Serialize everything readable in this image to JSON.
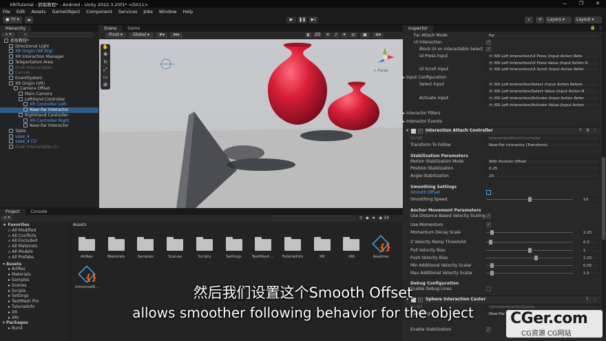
{
  "window": {
    "title": "XRITutorial - 抓取教程* - Android - Unity 2022.3.20f1* <DX11>",
    "controls": [
      "—",
      "❐",
      "✕"
    ]
  },
  "menu": [
    "File",
    "Edit",
    "Assets",
    "GameObject",
    "Component",
    "Services",
    "Jobs",
    "Window",
    "Help"
  ],
  "toolbar": {
    "account": "YY",
    "layers": "Layers",
    "layout": "Layout"
  },
  "hierarchy": {
    "tab": "Hierarchy",
    "search_placeholder": "All",
    "rows": [
      {
        "label": "抓取教程*",
        "indent": 0,
        "style": "normal"
      },
      {
        "label": "Directional Light",
        "indent": 1,
        "style": "normal"
      },
      {
        "label": "XR Origin (XR Rig)",
        "indent": 1,
        "style": "blue"
      },
      {
        "label": "XR Interaction Manager",
        "indent": 1,
        "style": "normal"
      },
      {
        "label": "Teleportation Area",
        "indent": 1,
        "style": "normal"
      },
      {
        "label": "Grab Interactable",
        "indent": 1,
        "style": "dim"
      },
      {
        "label": "Canvas",
        "indent": 1,
        "style": "dim"
      },
      {
        "label": "EventSystem",
        "indent": 1,
        "style": "normal"
      },
      {
        "label": "XR Origin (VR)",
        "indent": 1,
        "style": "normal"
      },
      {
        "label": "Camera Offset",
        "indent": 2,
        "style": "normal"
      },
      {
        "label": "Main Camera",
        "indent": 3,
        "style": "normal"
      },
      {
        "label": "LeftHand Controller",
        "indent": 3,
        "style": "normal"
      },
      {
        "label": "XR Controller Left",
        "indent": 4,
        "style": "blue"
      },
      {
        "label": "Near-Far Interactor",
        "indent": 4,
        "style": "selected"
      },
      {
        "label": "RightHand Controller",
        "indent": 3,
        "style": "normal"
      },
      {
        "label": "XR Controller Right",
        "indent": 4,
        "style": "blue"
      },
      {
        "label": "Near-Far Interactor",
        "indent": 4,
        "style": "normal"
      },
      {
        "label": "Table",
        "indent": 1,
        "style": "normal"
      },
      {
        "label": "vase_4",
        "indent": 1,
        "style": "blue"
      },
      {
        "label": "vase_4 (1)",
        "indent": 1,
        "style": "blue"
      },
      {
        "label": "Grab Interactable (1)",
        "indent": 1,
        "style": "dim"
      }
    ]
  },
  "scene": {
    "tabs": [
      "Scene",
      "Game"
    ],
    "pivot": "Pivot",
    "global": "Global",
    "mode_2d": "2D",
    "persp_label": "< Persp"
  },
  "project": {
    "tabs": [
      "Project",
      "Console"
    ],
    "favorites_header": "Favorites",
    "favorites": [
      "All Modified",
      "All Conflicts",
      "All Excluded",
      "All Materials",
      "All Models",
      "All Prefabs"
    ],
    "assets_header": "Assets",
    "asset_tree": [
      "ArtRes",
      "Materials",
      "Samples",
      "Scenes",
      "Scripts",
      "Settings",
      "TextMesh Pro",
      "TutorialInfo",
      "XR",
      "XRI"
    ],
    "packages_header": "Packages",
    "packages": [
      "Burst"
    ],
    "breadcrumb": "Assets",
    "count": "24",
    "items": [
      "ArtRes",
      "Materials",
      "Samples",
      "Scenes",
      "Scripts",
      "Settings",
      "TextMesh ...",
      "TutorialInfo",
      "XR",
      "XRI",
      "Readme",
      "UniversalR..."
    ]
  },
  "inspector": {
    "tab": "Inspector",
    "rows_top": [
      {
        "label": "Far Attach Mode",
        "value": "Far",
        "kind": "dropdown",
        "indent": 1
      },
      {
        "label": "UI Interaction",
        "value": "✓",
        "kind": "check",
        "indent": 1
      },
      {
        "label": "Block UI on Interactable Select",
        "value": "✓",
        "kind": "check",
        "indent": 2
      },
      {
        "label": "UI Press Input",
        "value": "XRI Left Interaction/UI Press (Input Action Refe",
        "kind": "field",
        "indent": 2
      },
      {
        "label": "",
        "value": "XRI Left Interaction/UI Press Value (Input Action R",
        "kind": "field",
        "indent": 2
      },
      {
        "label": "UI Scroll Input",
        "value": "XRI Left Interaction/UI Scroll (Input Action Refer",
        "kind": "field",
        "indent": 2
      },
      {
        "label": "Input Configuration",
        "value": "",
        "kind": "foldout",
        "indent": 0
      },
      {
        "label": "Select Input",
        "value": "XRI Left Interaction/Select (Input Action Refere",
        "kind": "field",
        "indent": 2
      },
      {
        "label": "",
        "value": "XRI Left Interaction/Select Value (Input Action R",
        "kind": "field",
        "indent": 2
      },
      {
        "label": "Activate Input",
        "value": "XRI Left Interaction/Activate (Input Action Refer",
        "kind": "field",
        "indent": 2
      },
      {
        "label": "",
        "value": "XRI Left Interaction/Activate Value (Input Action",
        "kind": "field",
        "indent": 2
      },
      {
        "label": "Interactor Filters",
        "value": "",
        "kind": "foldout",
        "indent": 0
      },
      {
        "label": "Interactor Events",
        "value": "",
        "kind": "foldout",
        "indent": 0
      }
    ],
    "component_title": "Interaction Attach Controller",
    "script_label": "Script",
    "script_value": "InteractionAttachController",
    "transform_label": "Transform To Follow",
    "transform_value": "Near-Far Interactor (Transform)",
    "stab_header": "Stabilization Parameters",
    "stab_rows": [
      {
        "label": "Motion Stabilization Mode",
        "value": "With Position Offset",
        "kind": "dropdown"
      },
      {
        "label": "Position Stabilization",
        "value": "0.25",
        "kind": "field"
      },
      {
        "label": "Angle Stabilization",
        "value": "20",
        "kind": "field"
      }
    ],
    "smooth_header": "Smoothing Settings",
    "smooth_offset_label": "Smooth Offset",
    "smooth_speed_label": "Smoothing Speed",
    "smooth_speed_value": "10",
    "smooth_speed_fraction": 0.5,
    "anchor_header": "Anchor Movement Parameters",
    "anchor_rows": [
      {
        "label": "Use Distance Based Velocity Scaling",
        "kind": "check",
        "value": "✓"
      },
      {
        "label": "Use Momentum",
        "kind": "check",
        "value": "✓"
      },
      {
        "label": "Momentum Decay Scale",
        "kind": "slider",
        "value": "1.25",
        "fraction": 0.05
      },
      {
        "label": "Z Velocity Ramp Threshold",
        "kind": "slider",
        "value": "0.3",
        "fraction": 0.03
      },
      {
        "label": "Pull Velocity Bias",
        "kind": "slider",
        "value": "1",
        "fraction": 0.5
      },
      {
        "label": "Push Velocity Bias",
        "kind": "slider",
        "value": "1.25",
        "fraction": 0.58
      },
      {
        "label": "Min Additional Velocity Scalar",
        "kind": "slider",
        "value": "0.05",
        "fraction": 0.05
      },
      {
        "label": "Max Additional Velocity Scalar",
        "kind": "slider",
        "value": "1.5",
        "fraction": 0.05
      }
    ],
    "debug_header": "Debug Configuration",
    "debug_row": "Enable Debug Lines",
    "second_component": "Sphere Interaction Caster",
    "second_script_label": "Script",
    "second_script_value": "SphereInteractionCaster",
    "cast_origin_label": "Cast Origin",
    "cast_origin_value": "Near-Far Interactor (Transform)",
    "enable_stab_label": "Enable Stabilization"
  },
  "subtitles": {
    "chinese": "然后我们设置这个Smooth Offset",
    "english": "allows smoother following behavior for the object"
  },
  "watermark": {
    "brand": "CGer.com",
    "sub": "CG资源 CG网站"
  }
}
